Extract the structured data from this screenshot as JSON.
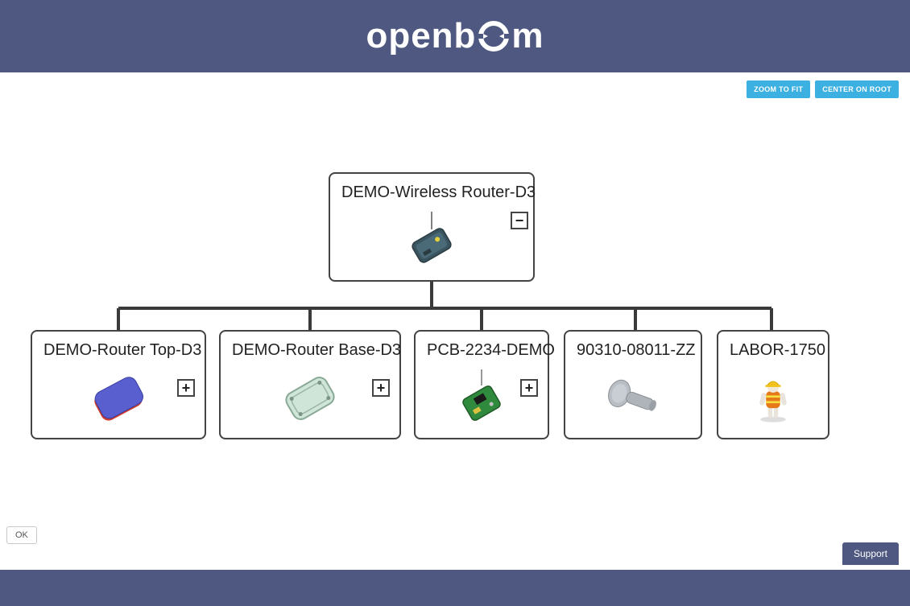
{
  "brand": {
    "name": "openbom"
  },
  "toolbar": {
    "zoom_to_fit": "ZOOM TO FIT",
    "center_on_root": "CENTER ON ROOT"
  },
  "footer": {
    "ok": "OK",
    "support": "Support"
  },
  "tree": {
    "root": {
      "label": "DEMO-Wireless Router-D3",
      "toggle": "−",
      "icon": "router-device"
    },
    "children": [
      {
        "label": "DEMO-Router Top-D3",
        "toggle": "+",
        "icon": "top-cover"
      },
      {
        "label": "DEMO-Router Base-D3",
        "toggle": "+",
        "icon": "base-shell"
      },
      {
        "label": "PCB-2234-DEMO",
        "toggle": "+",
        "icon": "pcb-board"
      },
      {
        "label": "90310-08011-ZZ",
        "toggle": null,
        "icon": "screw"
      },
      {
        "label": "LABOR-1750",
        "toggle": null,
        "icon": "worker"
      }
    ]
  }
}
